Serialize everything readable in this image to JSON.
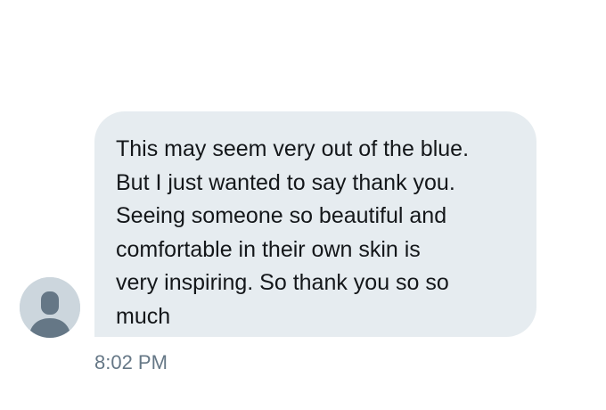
{
  "conversation": {
    "received_message": {
      "text": "This may seem very out of the blue.\nBut I just wanted to say thank you.\nSeeing someone so beautiful and\ncomfortable in their own skin is\nvery inspiring. So thank you so so\nmuch",
      "timestamp": "8:02 PM",
      "sender_avatar_icon": "default-user-avatar-icon"
    }
  },
  "colors": {
    "bubble_background": "#e6ecf0",
    "message_text": "#14171a",
    "timestamp_text": "#657786",
    "avatar_background": "#ccd6dd",
    "avatar_silhouette": "#657786"
  }
}
